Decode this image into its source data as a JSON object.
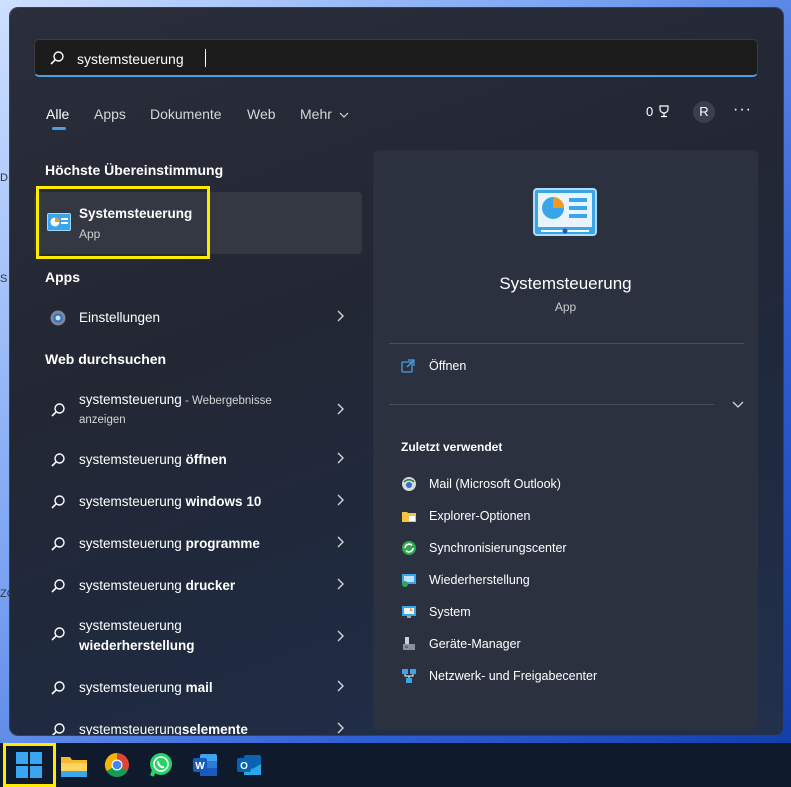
{
  "search": {
    "value": "systemsteuerung"
  },
  "tabs": [
    {
      "label": "Alle"
    },
    {
      "label": "Apps"
    },
    {
      "label": "Dokumente"
    },
    {
      "label": "Web"
    },
    {
      "label": "Mehr"
    }
  ],
  "rewards": {
    "count": "0"
  },
  "account": {
    "initial": "R"
  },
  "sections": {
    "best_match": "Höchste Übereinstimmung",
    "apps": "Apps",
    "web": "Web durchsuchen"
  },
  "best_match": {
    "title": "Systemsteuerung",
    "type": "App"
  },
  "apps": [
    {
      "label": "Einstellungen"
    }
  ],
  "web_results": [
    {
      "normal": "systemsteuerung",
      "suffix": " - Webergebnisse",
      "line2": "anzeigen"
    },
    {
      "normal": "systemsteuerung ",
      "bold": "öffnen"
    },
    {
      "normal": "systemsteuerung ",
      "bold": "windows 10"
    },
    {
      "normal": "systemsteuerung ",
      "bold": "programme"
    },
    {
      "normal": "systemsteuerung ",
      "bold": "drucker"
    },
    {
      "normal": "systemsteuerung",
      "bold": "wiederherstellung"
    },
    {
      "normal": "systemsteuerung ",
      "bold": "mail"
    },
    {
      "normal": "systemsteuerung",
      "bold": "selemente"
    }
  ],
  "detail": {
    "title": "Systemsteuerung",
    "type": "App",
    "open_label": "Öffnen",
    "recent_heading": "Zuletzt verwendet",
    "recent": [
      {
        "label": "Mail (Microsoft Outlook)",
        "icon": "mail-globe-icon"
      },
      {
        "label": "Explorer-Optionen",
        "icon": "folder-options-icon"
      },
      {
        "label": "Synchronisierungscenter",
        "icon": "sync-icon"
      },
      {
        "label": "Wiederherstellung",
        "icon": "recovery-icon"
      },
      {
        "label": "System",
        "icon": "system-icon"
      },
      {
        "label": "Geräte-Manager",
        "icon": "device-manager-icon"
      },
      {
        "label": "Netzwerk- und Freigabecenter",
        "icon": "network-icon"
      }
    ]
  },
  "desktop_fragments": [
    "D",
    "S",
    "ZO"
  ],
  "colors": {
    "accent": "#4aa0e8",
    "highlight": "#ffeb00"
  }
}
